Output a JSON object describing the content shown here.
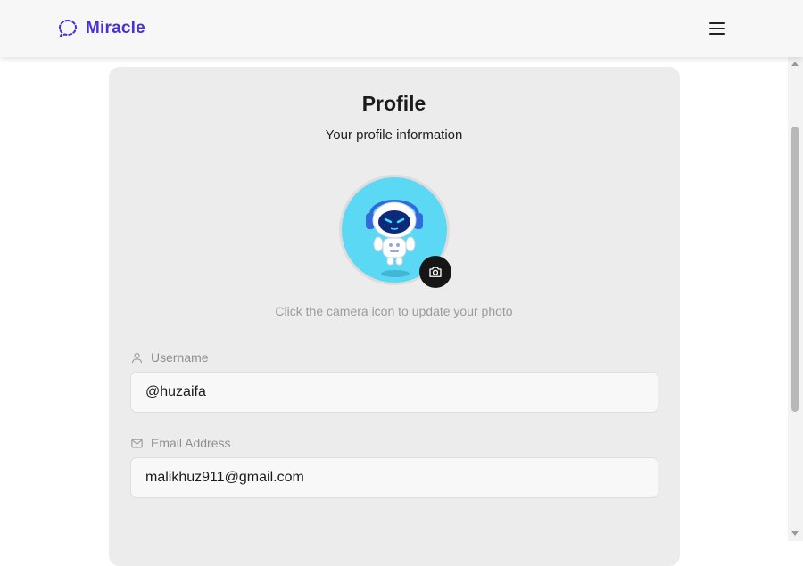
{
  "header": {
    "brand_name": "Miracle",
    "brand_icon": "chat-bubble-dashed-icon",
    "menu_icon": "hamburger-menu-icon",
    "brand_color": "#4a2fd3"
  },
  "profile": {
    "title": "Profile",
    "subtitle": "Your profile information",
    "avatar_bg": "#5ad8f4",
    "camera_icon": "camera-icon",
    "hint": "Click the camera icon to update your photo"
  },
  "fields": {
    "username": {
      "label": "Username",
      "icon": "user-icon",
      "value": "@huzaifa"
    },
    "email": {
      "label": "Email Address",
      "icon": "mail-icon",
      "value": "malikhuz911@gmail.com"
    }
  }
}
